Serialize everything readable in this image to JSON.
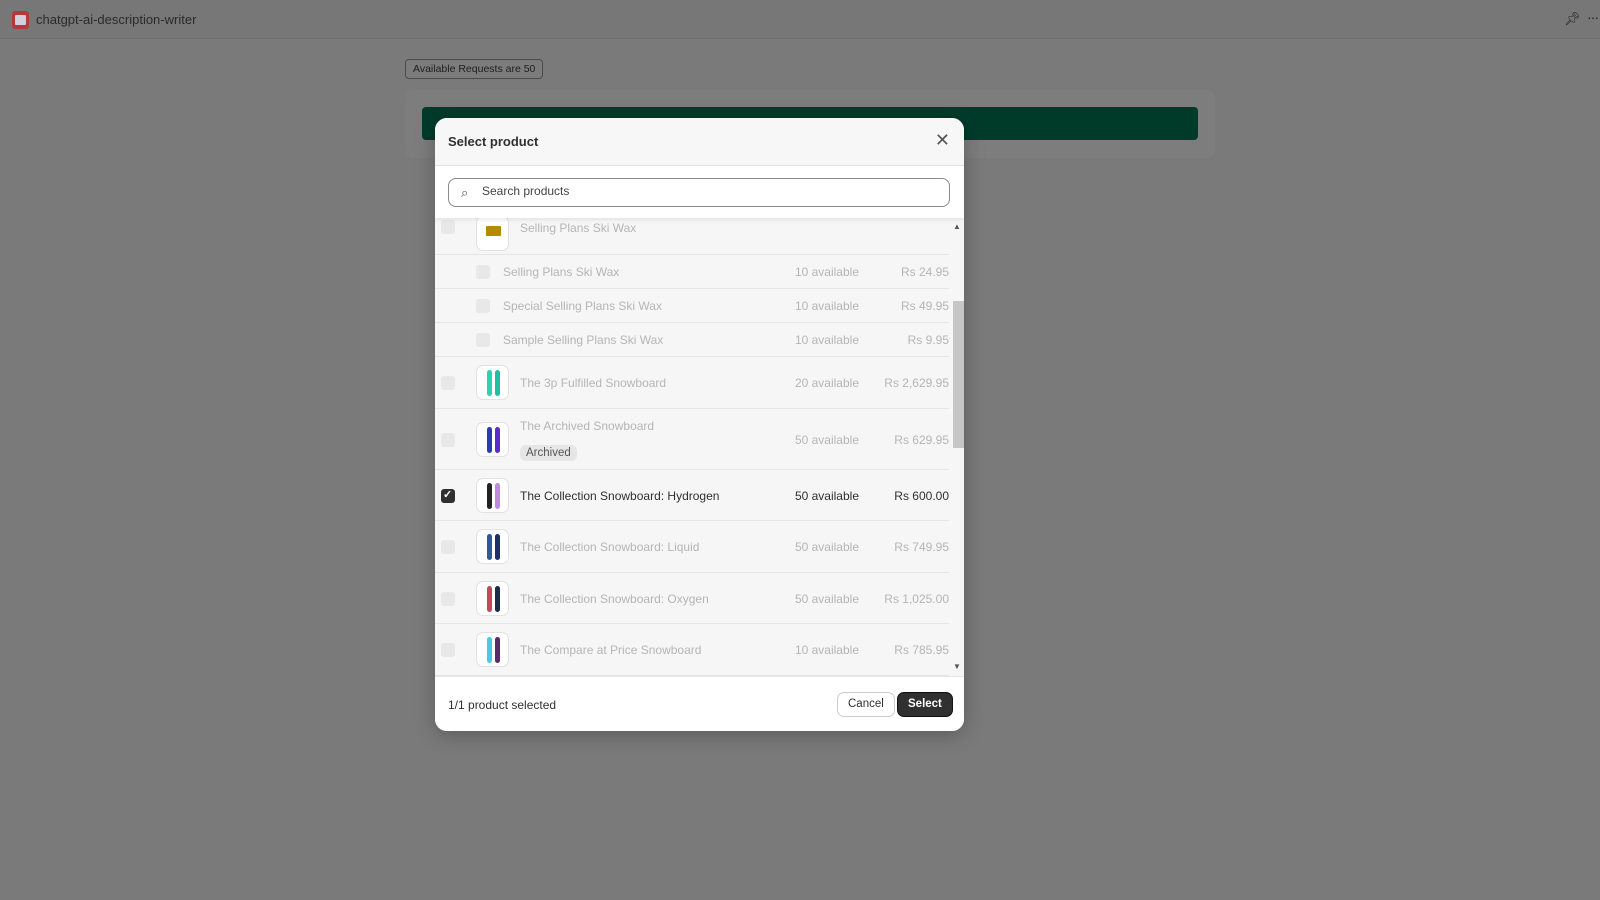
{
  "app": {
    "title": "chatgpt-ai-description-writer",
    "icon": "app-notepad-icon",
    "pin_icon": "pin-icon",
    "more_icon": "more-dots-icon"
  },
  "page": {
    "badge": "Available Requests are 50",
    "primary_color": "#003b2a"
  },
  "modal": {
    "title": "Select product",
    "search_placeholder": "Search products",
    "search_value": "",
    "parent": {
      "name": "Selling Plans Ski Wax"
    },
    "variants": [
      {
        "name": "Selling Plans Ski Wax",
        "available": "10 available",
        "price": "Rs 24.95"
      },
      {
        "name": "Special Selling Plans Ski Wax",
        "available": "10 available",
        "price": "Rs 49.95"
      },
      {
        "name": "Sample Selling Plans Ski Wax",
        "available": "10 available",
        "price": "Rs 9.95"
      }
    ],
    "products": [
      {
        "name": "The 3p Fulfilled Snowboard",
        "available": "20 available",
        "price": "Rs 2,629.95",
        "checked": false,
        "tag": ""
      },
      {
        "name": "The Archived Snowboard",
        "available": "50 available",
        "price": "Rs 629.95",
        "checked": false,
        "tag": "Archived"
      },
      {
        "name": "The Collection Snowboard: Hydrogen",
        "available": "50 available",
        "price": "Rs 600.00",
        "checked": true,
        "tag": ""
      },
      {
        "name": "The Collection Snowboard: Liquid",
        "available": "50 available",
        "price": "Rs 749.95",
        "checked": false,
        "tag": ""
      },
      {
        "name": "The Collection Snowboard: Oxygen",
        "available": "50 available",
        "price": "Rs 1,025.00",
        "checked": false,
        "tag": ""
      },
      {
        "name": "The Compare at Price Snowboard",
        "available": "10 available",
        "price": "Rs 785.95",
        "checked": false,
        "tag": ""
      }
    ],
    "footer": {
      "count": "1/1 product selected",
      "cancel": "Cancel",
      "select": "Select"
    }
  }
}
